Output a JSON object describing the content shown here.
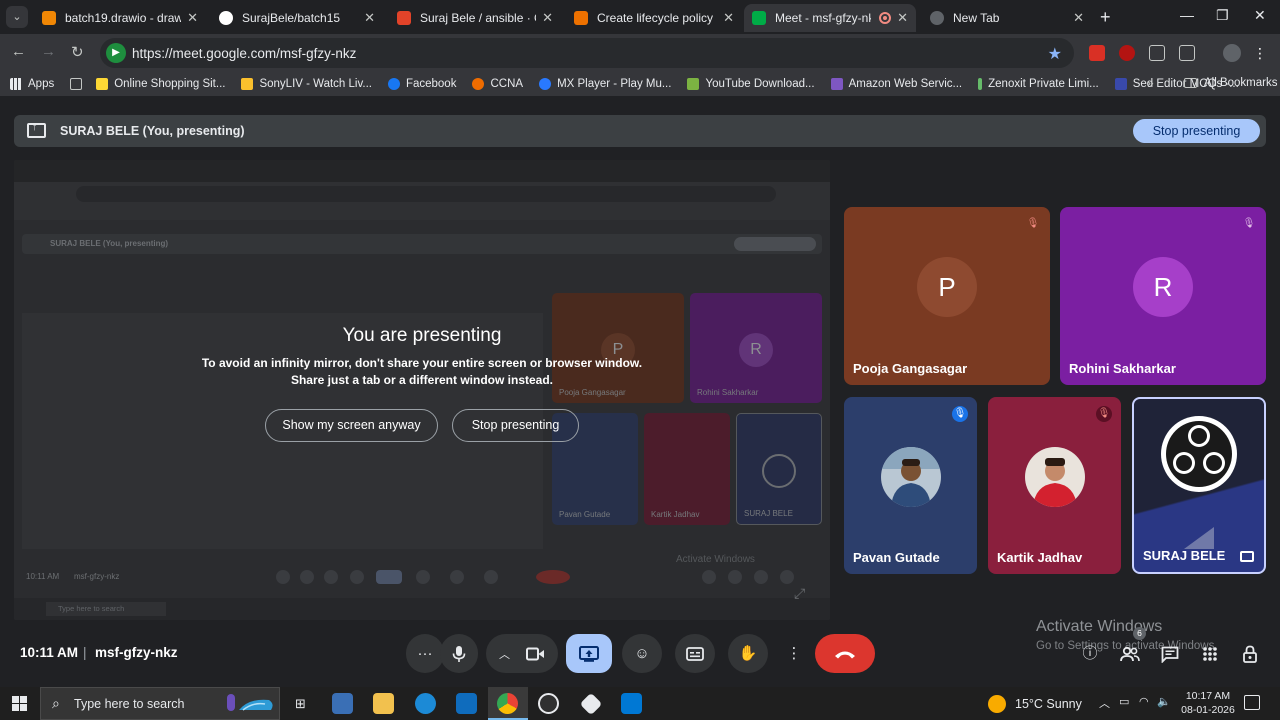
{
  "browser": {
    "tabs": [
      {
        "title": "batch19.drawio - draw.io",
        "icon": "github-icon",
        "color": "#f08705"
      },
      {
        "title": "SurajBele/batch15",
        "icon": "github-icon",
        "color": "#ffffff"
      },
      {
        "title": "Suraj Bele / ansible · GitLab",
        "icon": "gitlab-icon",
        "color": "#e24329"
      },
      {
        "title": "Create lifecycle policy | EC2",
        "icon": "aws-icon",
        "color": "#ed7100"
      },
      {
        "title": "Meet - msf-gfzy-nkz",
        "icon": "meet-icon",
        "color": "#00ac47",
        "active": true
      },
      {
        "title": "New Tab",
        "icon": "chrome-icon",
        "color": "#c4c7c5"
      }
    ],
    "url": "https://meet.google.com/msf-gfzy-nkz",
    "bookmarks": [
      {
        "label": "Apps",
        "color": "#e8eaed"
      },
      {
        "label": "Online Shopping Sit...",
        "color": "#fdd835"
      },
      {
        "label": "SonyLIV - Watch Liv...",
        "color": "#fbc02d"
      },
      {
        "label": "Facebook",
        "color": "#1877f2"
      },
      {
        "label": "CCNA",
        "color": "#ef6c00"
      },
      {
        "label": "MX Player - Play Mu...",
        "color": "#2979ff"
      },
      {
        "label": "YouTube Download...",
        "color": "#7cb342"
      },
      {
        "label": "Amazon Web Servic...",
        "color": "#7e57c2"
      },
      {
        "label": "Zenoxit Private Limi...",
        "color": "#66bb6a"
      },
      {
        "label": "Sed Editor MCQs -...",
        "color": "#3949ab"
      }
    ],
    "all_bookmarks": "All Bookmarks"
  },
  "meet": {
    "presenter_banner": "SURAJ BELE (You, presenting)",
    "stop_presenting_label": "Stop presenting",
    "message": {
      "title": "You are presenting",
      "line1": "To avoid an infinity mirror, don't share your entire screen or browser window.",
      "line2": "Share just a tab or a different window instead.",
      "show_anyway": "Show my screen anyway",
      "stop": "Stop presenting"
    },
    "participants": [
      {
        "name": "Pooja Gangasagar",
        "initial": "P",
        "bg": "#7a3a22",
        "avatar_bg": "#8e4a30",
        "muted": true
      },
      {
        "name": "Rohini Sakharkar",
        "initial": "R",
        "bg": "#7b1fa2",
        "avatar_bg": "#a63fc9",
        "muted": true
      },
      {
        "name": "Pavan Gutade",
        "bg": "#2c3e6b",
        "muted": true
      },
      {
        "name": "Kartik Jadhav",
        "bg": "#8a1f3d",
        "muted": true
      },
      {
        "name": "SURAJ BELE",
        "bg": "#1e2a5a"
      }
    ],
    "time": "10:11 AM",
    "separator": "|",
    "meeting_code": "msf-gfzy-nkz",
    "people_count": "6",
    "mirror": {
      "banner": "SURAJ BELE (You, presenting)",
      "names": [
        "Pooja Gangasagar",
        "Rohini Sakharkar",
        "Pavan Gutade",
        "Kartik Jadhav",
        "SURAJ BELE"
      ],
      "initials": [
        "P",
        "R"
      ],
      "time": "10:11 AM",
      "code": "msf-gfzy-nkz",
      "search": "Type here to search"
    }
  },
  "watermark": {
    "line1": "Activate Windows",
    "line2": "Go to Settings to activate Windows."
  },
  "taskbar": {
    "search_placeholder": "Type here to search",
    "weather": "15°C  Sunny",
    "time": "10:17 AM",
    "date": "08-01-2026"
  }
}
